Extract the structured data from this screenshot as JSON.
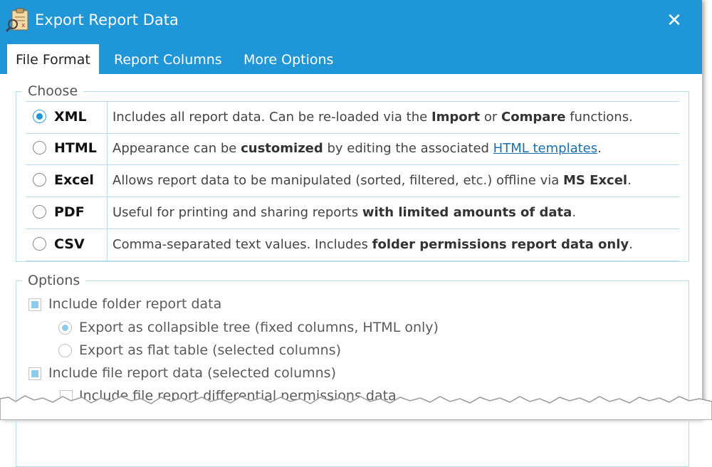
{
  "window": {
    "title": "Export Report Data",
    "close_glyph": "✕"
  },
  "tabs": [
    {
      "label": "File Format",
      "active": true
    },
    {
      "label": "Report Columns",
      "active": false
    },
    {
      "label": "More Options",
      "active": false
    }
  ],
  "choose": {
    "legend": "Choose",
    "formats": [
      {
        "label": "XML",
        "selected": true,
        "desc": [
          {
            "t": "Includes all report data. Can be re-loaded via the "
          },
          {
            "t": "Import",
            "b": true
          },
          {
            "t": " or "
          },
          {
            "t": "Compare",
            "b": true
          },
          {
            "t": " functions."
          }
        ]
      },
      {
        "label": "HTML",
        "selected": false,
        "desc": [
          {
            "t": "Appearance can be "
          },
          {
            "t": "customized",
            "b": true
          },
          {
            "t": " by editing the associated "
          },
          {
            "t": "HTML templates",
            "link": true
          },
          {
            "t": "."
          }
        ]
      },
      {
        "label": "Excel",
        "selected": false,
        "desc": [
          {
            "t": "Allows report data to be manipulated (sorted, filtered, etc.) offline via "
          },
          {
            "t": "MS Excel",
            "b": true
          },
          {
            "t": "."
          }
        ]
      },
      {
        "label": "PDF",
        "selected": false,
        "desc": [
          {
            "t": "Useful for printing and sharing reports "
          },
          {
            "t": "with limited amounts of data",
            "b": true
          },
          {
            "t": "."
          }
        ]
      },
      {
        "label": "CSV",
        "selected": false,
        "desc": [
          {
            "t": "Comma-separated text values. Includes "
          },
          {
            "t": "folder permissions report data only",
            "b": true
          },
          {
            "t": "."
          }
        ]
      }
    ]
  },
  "options": {
    "legend": "Options",
    "include_folder": {
      "label": "Include folder report data",
      "checked": true
    },
    "export_tree": {
      "label": "Export as collapsible tree (fixed columns, HTML only)",
      "selected": true
    },
    "export_flat": {
      "label": "Export as flat table (selected columns)",
      "selected": false
    },
    "include_file": {
      "label": "Include file report data (selected columns)",
      "checked": true
    },
    "include_diff": {
      "label": "Include file report differential permissions data",
      "checked": false
    }
  },
  "colors": {
    "titlebar": "#1e96d8",
    "accent": "#1e96d8",
    "border": "#b9dcec"
  }
}
